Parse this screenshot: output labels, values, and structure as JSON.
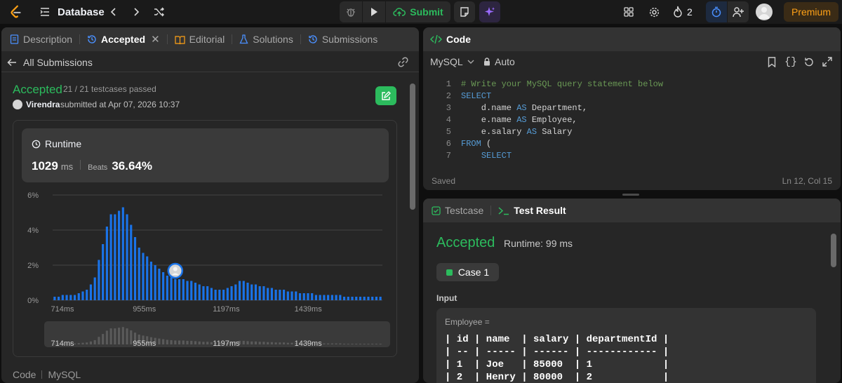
{
  "topbar": {
    "problem_list_label": "Database",
    "submit_label": "Submit",
    "streak_count": "2",
    "premium_label": "Premium"
  },
  "left": {
    "tabs": [
      "Description",
      "Accepted",
      "Editorial",
      "Solutions",
      "Submissions"
    ],
    "back_label": "All Submissions",
    "status": "Accepted",
    "testcases": "21 / 21 testcases passed",
    "user": "Virendra",
    "submitted_text": "submitted at Apr 07, 2026 10:37",
    "runtime_title": "Runtime",
    "runtime_value": "1029",
    "runtime_unit": "ms",
    "beats_label": "Beats",
    "beats_value": "36.64%",
    "footer_code": "Code",
    "footer_lang": "MySQL"
  },
  "chart_data": {
    "type": "bar",
    "ylabel": "",
    "xlabel": "",
    "yticks": [
      "6%",
      "4%",
      "2%",
      "0%"
    ],
    "ylim": [
      0,
      6
    ],
    "xticks": [
      "714ms",
      "955ms",
      "1197ms",
      "1439ms"
    ],
    "values": [
      0.2,
      0.2,
      0.3,
      0.3,
      0.3,
      0.3,
      0.4,
      0.5,
      0.6,
      0.9,
      1.3,
      2.3,
      3.2,
      4.2,
      4.9,
      4.9,
      5.1,
      5.3,
      4.9,
      4.3,
      3.6,
      3.0,
      2.7,
      2.5,
      2.2,
      2.0,
      1.8,
      1.6,
      1.4,
      1.3,
      1.2,
      1.2,
      1.2,
      1.1,
      1.1,
      1.0,
      0.9,
      0.8,
      0.8,
      0.7,
      0.6,
      0.6,
      0.6,
      0.7,
      0.8,
      0.9,
      1.1,
      1.1,
      1.0,
      0.9,
      0.9,
      0.8,
      0.8,
      0.7,
      0.7,
      0.6,
      0.6,
      0.6,
      0.5,
      0.5,
      0.5,
      0.4,
      0.4,
      0.4,
      0.4,
      0.3,
      0.3,
      0.3,
      0.3,
      0.3,
      0.3,
      0.3,
      0.2,
      0.2,
      0.2,
      0.2,
      0.2,
      0.2,
      0.2,
      0.2,
      0.2,
      0.2
    ],
    "highlight_index": 30,
    "bar_color": "#1a73e8",
    "mini_color": "#5a5a5a",
    "grid": true
  },
  "right": {
    "code_tab": "Code",
    "lang": "MySQL",
    "auto_label": "Auto",
    "code_lines": [
      {
        "n": "1",
        "html": "<span class='cm'># Write your MySQL query statement below</span>"
      },
      {
        "n": "2",
        "html": "<span class='kw'>SELECT</span>"
      },
      {
        "n": "3",
        "html": "    d.name <span class='kw'>AS</span> Department,"
      },
      {
        "n": "4",
        "html": "    e.name <span class='kw'>AS</span> Employee,"
      },
      {
        "n": "5",
        "html": "    e.salary <span class='kw'>AS</span> Salary"
      },
      {
        "n": "6",
        "html": "<span class='kw'>FROM</span> ("
      },
      {
        "n": "7",
        "html": "    <span class='kw'>SELECT</span>"
      }
    ],
    "saved_label": "Saved",
    "cursor_pos": "Ln 12, Col 15",
    "testcase_tab": "Testcase",
    "result_tab": "Test Result",
    "result_status": "Accepted",
    "result_runtime": "Runtime: 99 ms",
    "case_label": "Case 1",
    "input_label": "Input",
    "table_name": "Employee =",
    "table_lines": [
      "| id | name  | salary | departmentId |",
      "| -- | ----- | ------ | ------------ |",
      "| 1  | Joe   | 85000  | 1            |",
      "| 2  | Henry | 80000  | 2            |"
    ]
  }
}
